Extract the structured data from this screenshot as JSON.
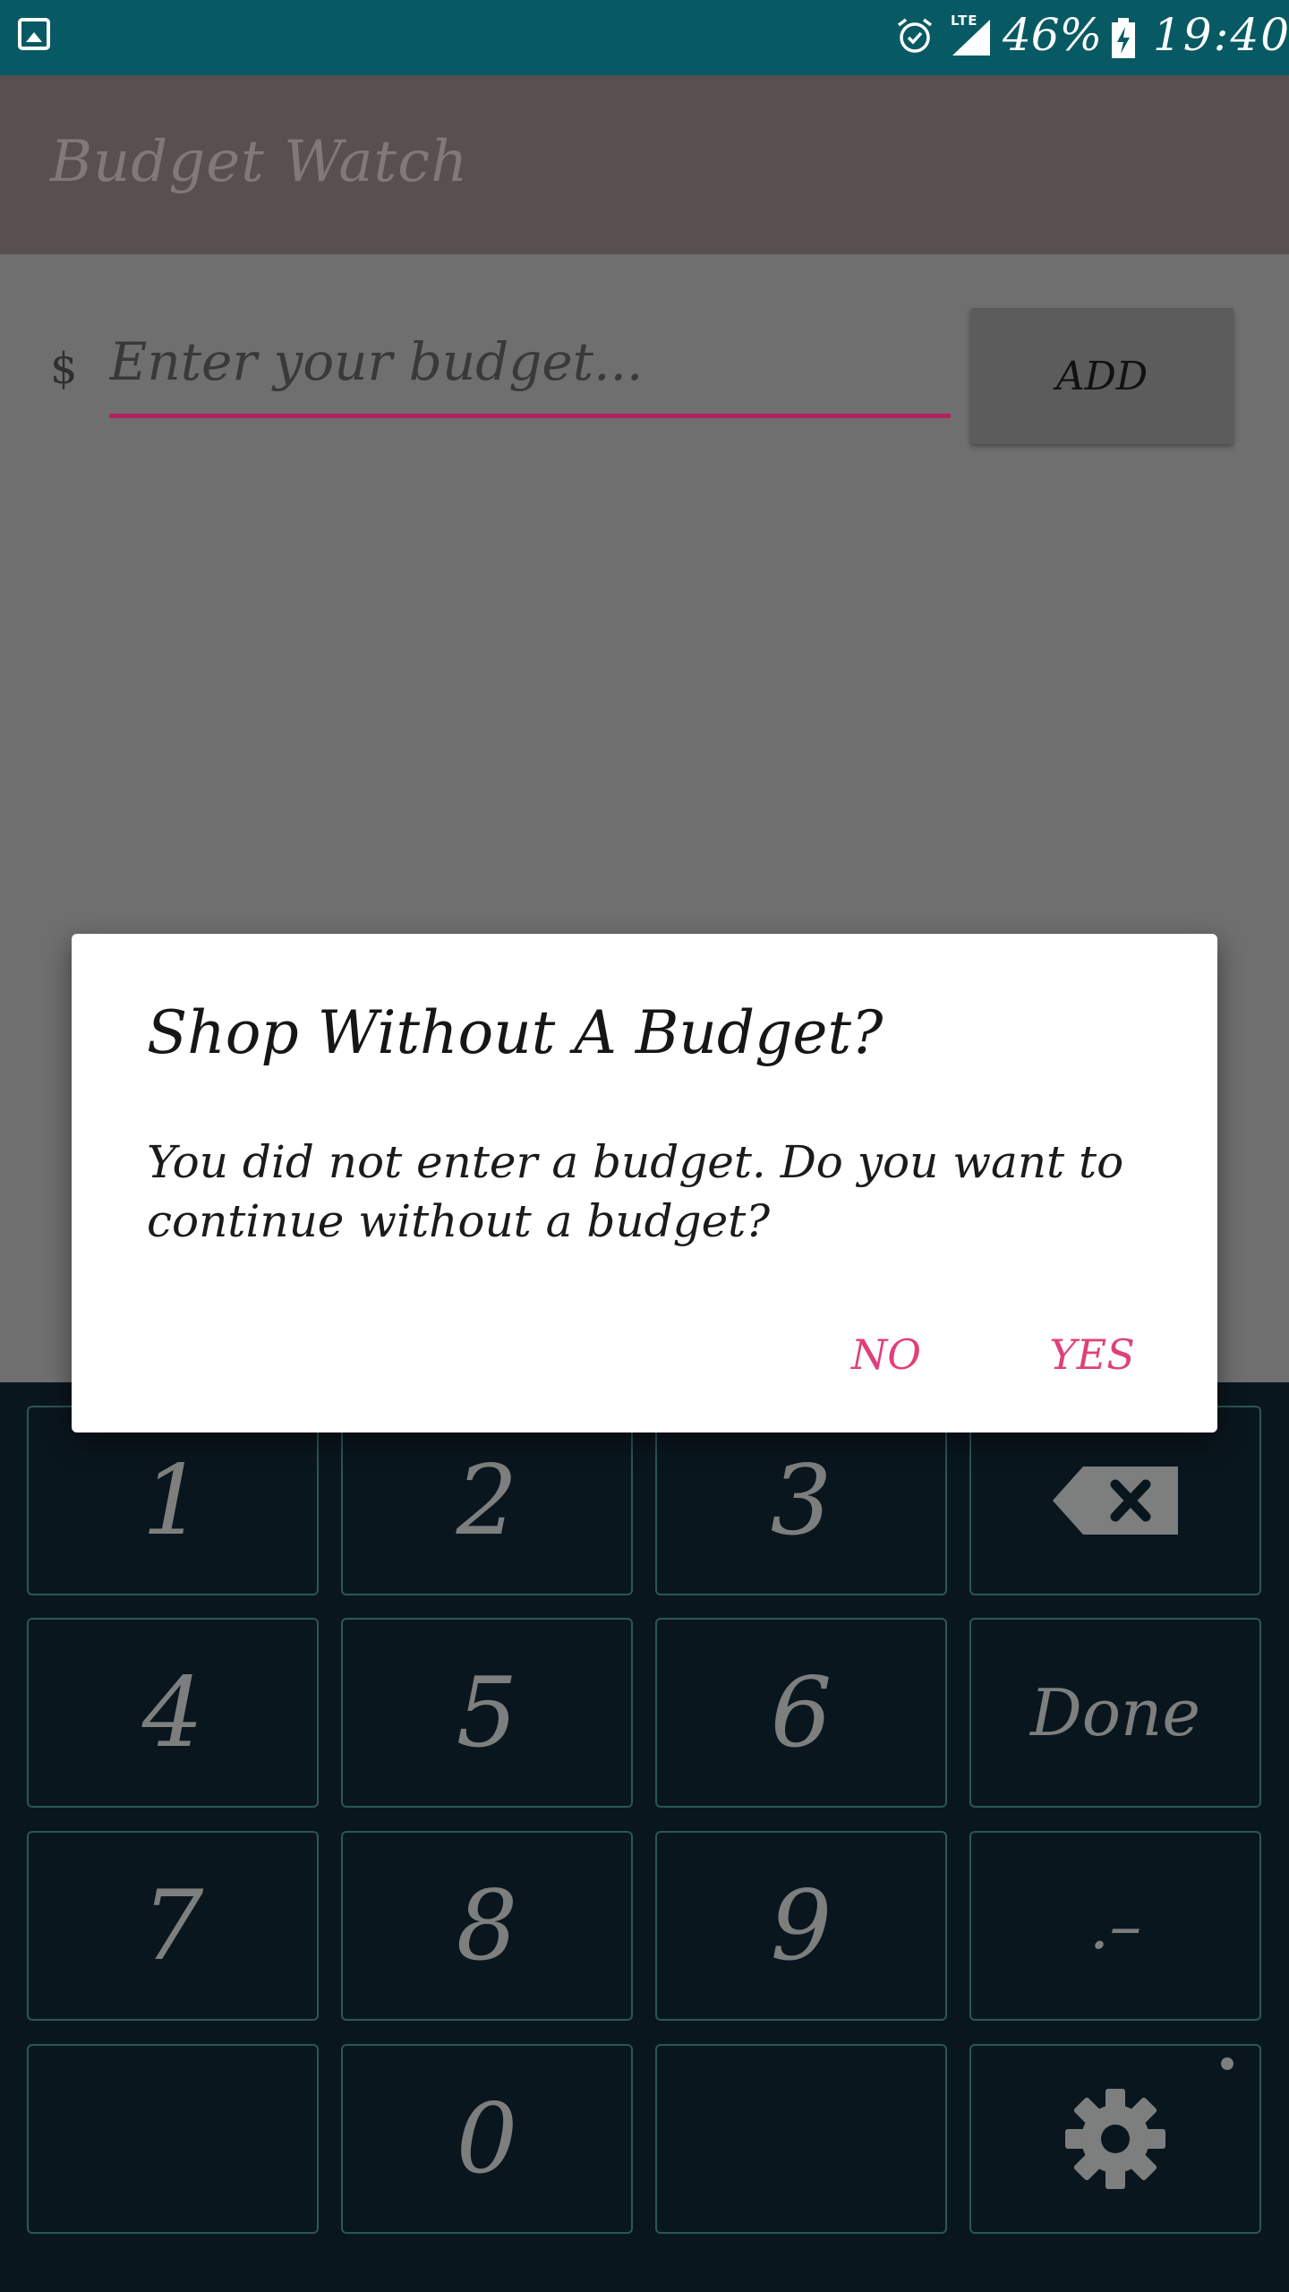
{
  "status_bar": {
    "icons": [
      "gallery-icon",
      "alarm-icon",
      "signal-icon",
      "battery-charging-icon"
    ],
    "network": "LTE",
    "battery": "46%",
    "time": "19:40"
  },
  "app_bar": {
    "title": "Budget Watch"
  },
  "budget_form": {
    "currency_symbol": "$",
    "placeholder": "Enter your budget...",
    "value": "",
    "add_label": "ADD"
  },
  "dialog": {
    "title": "Shop Without A Budget?",
    "message": "You did not enter a budget. Do you want to continue without a budget?",
    "no_label": "NO",
    "yes_label": "YES"
  },
  "keyboard": {
    "keys": {
      "k1": "1",
      "k2": "2",
      "k3": "3",
      "k4": "4",
      "k5": "5",
      "k6": "6",
      "k7": "7",
      "k8": "8",
      "k9": "9",
      "k0": "0",
      "done": "Done",
      "dot": ".–"
    },
    "icons": [
      "backspace-icon",
      "gear-icon"
    ]
  },
  "colors": {
    "status_bar": "#075a64",
    "accent": "#e0407a",
    "underline": "#b2235e",
    "keyboard_bg": "#0a161d",
    "key_border": "#2b5658"
  }
}
